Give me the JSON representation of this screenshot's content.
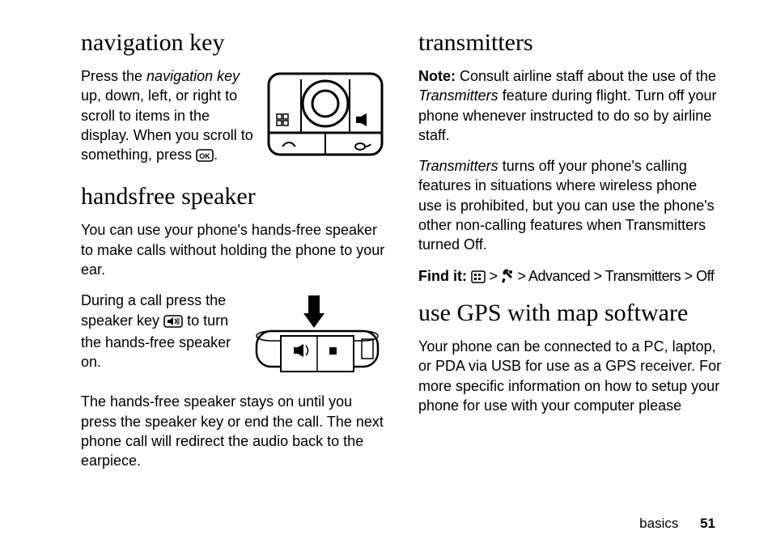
{
  "left": {
    "nav": {
      "heading": "navigation key",
      "para1_a": "Press the ",
      "para1_em": "navigation key",
      "para1_b": " up, down, left, or right to scroll to items in the display. When you scroll to something, press ",
      "para1_c": "."
    },
    "hands": {
      "heading": "handsfree speaker",
      "para1": "You can use your phone's hands-free speaker to make calls without holding the phone to your ear.",
      "para2_a": "During a call press the speaker key ",
      "para2_b": " to turn the hands-free speaker on.",
      "para3": "The hands-free speaker stays on until you press the speaker key or end the call. The next phone call will redirect the audio back to the earpiece."
    }
  },
  "right": {
    "trans": {
      "heading": "transmitters",
      "para1_a": "Note:",
      "para1_b": " Consult airline staff about the use of the ",
      "para1_em": "Transmitters",
      "para1_c": " feature during flight. Turn off your phone whenever instructed to do so by airline staff.",
      "para2_em": "Transmitters",
      "para2_b": " turns off your phone's calling features in situations where wireless phone use is prohibited, but you can use the phone's other non-calling features when Transmitters turned Off.",
      "find_label": "Find it:",
      "find_path_a": " > ",
      "find_path_b": " > Advanced > Transmitters > Off"
    },
    "gps": {
      "heading": "use GPS with map software",
      "para1": "Your phone can be connected to a PC, laptop, or PDA via USB for use as a GPS receiver. For more specific information on how to setup your phone for use with your computer please"
    }
  },
  "footer": {
    "section": "basics",
    "page": "51"
  },
  "icons": {
    "ok": "ok-button-icon",
    "speaker": "speaker-key-icon",
    "menu": "menu-grid-icon",
    "settings": "settings-tools-icon",
    "nav_illustration": "navigation-key-illustration",
    "speaker_illustration": "speaker-key-illustration"
  }
}
